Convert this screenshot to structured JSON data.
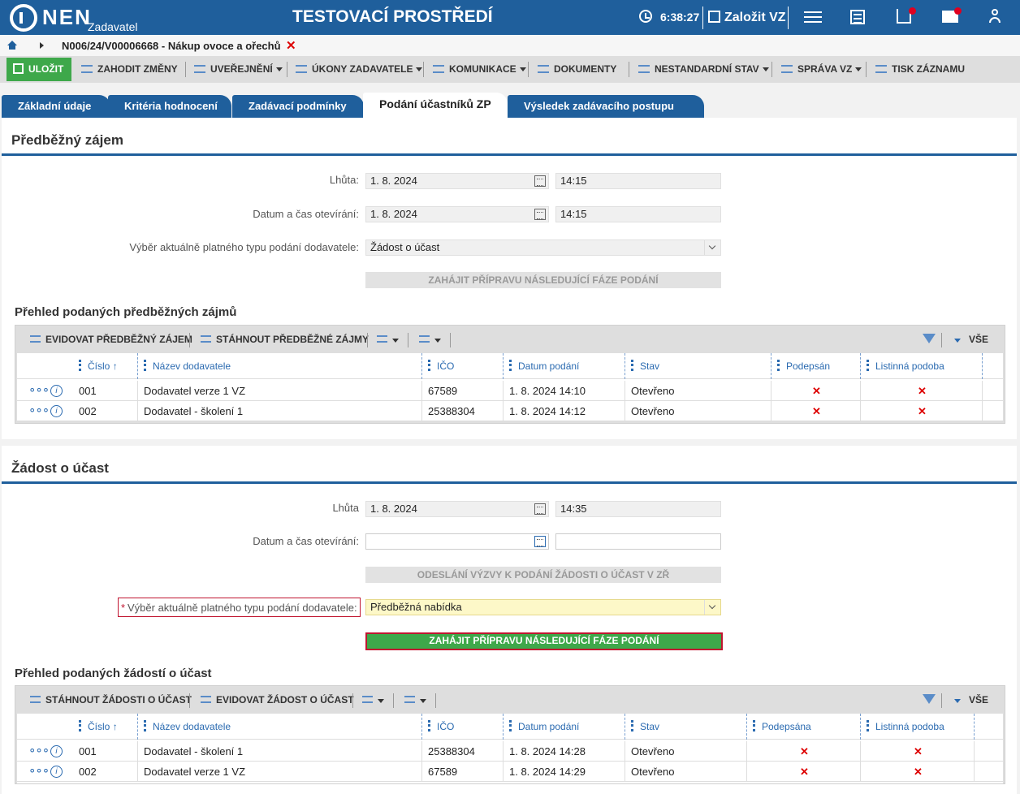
{
  "header": {
    "brand": "NEN",
    "brand_sub": "Zadavatel",
    "environment": "TESTOVACÍ PROSTŘEDÍ",
    "time": "6:38:27",
    "new_vz": "Založit VZ"
  },
  "breadcrumb": {
    "text": "N006/24/V00006668 - Nákup ovoce a ořechů",
    "close": "✕"
  },
  "toolbar": {
    "save": "ULOŽIT",
    "discard": "ZAHODIT ZMĚNY",
    "publishing": "UVEŘEJNĚNÍ",
    "actions": "ÚKONY ZADAVATELE",
    "communication": "KOMUNIKACE",
    "documents": "DOKUMENTY",
    "nonstandard": "NESTANDARDNÍ STAV",
    "management": "SPRÁVA VZ",
    "print": "TISK ZÁZNAMU"
  },
  "tabs": [
    "Základní údaje",
    "Kritéria hodnocení",
    "Zadávací podmínky",
    "Podání účastníků ZP",
    "Výsledek zadávacího postupu"
  ],
  "section1": {
    "title": "Předběžný zájem",
    "deadline_label": "Lhůta:",
    "deadline_date": "1. 8. 2024",
    "deadline_time": "14:15",
    "opening_label": "Datum a čas otevírání:",
    "opening_date": "1. 8. 2024",
    "opening_time": "14:15",
    "type_label": "Výběr aktuálně platného typu podání dodavatele:",
    "type_value": "Žádost o účast",
    "start_button": "ZAHÁJIT PŘÍPRAVU NÁSLEDUJÍCÍ FÁZE PODÁNÍ",
    "grid_title": "Přehled podaných předběžných zájmů",
    "grid_btn1": "EVIDOVAT PŘEDBĚŽNÝ ZÁJEM",
    "grid_btn2": "STÁHNOUT PŘEDBĚŽNÉ ZÁJMY",
    "all": "VŠE",
    "columns": [
      "Číslo",
      "Název dodavatele",
      "IČO",
      "Datum podání",
      "Stav",
      "Podepsán",
      "Listinná podoba"
    ],
    "rows": [
      {
        "no": "001",
        "name": "Dodavatel verze 1 VZ",
        "ico": "67589",
        "date": "1. 8. 2024 14:10",
        "state": "Otevřeno",
        "signed": "✕",
        "paper": "✕"
      },
      {
        "no": "002",
        "name": "Dodavatel - školení 1",
        "ico": "25388304",
        "date": "1. 8. 2024 14:12",
        "state": "Otevřeno",
        "signed": "✕",
        "paper": "✕"
      }
    ]
  },
  "section2": {
    "title": "Žádost o účast",
    "deadline_label": "Lhůta",
    "deadline_date": "1. 8. 2024",
    "deadline_time": "14:35",
    "opening_label": "Datum a čas otevírání:",
    "opening_date": "",
    "opening_time": "",
    "send_button": "ODESLÁNÍ VÝZVY K PODÁNÍ ŽÁDOSTI O ÚČAST V ZŘ",
    "type_label": "Výběr aktuálně platného typu podání dodavatele:",
    "required_mark": "*",
    "type_value": "Předběžná nabídka",
    "start_button": "ZAHÁJIT PŘÍPRAVU NÁSLEDUJÍCÍ FÁZE PODÁNÍ",
    "grid_title": "Přehled podaných žádostí o účast",
    "grid_btn1": "STÁHNOUT ŽÁDOSTI O ÚČAST",
    "grid_btn2": "EVIDOVAT ŽÁDOST O ÚČAST",
    "all": "VŠE",
    "columns": [
      "Číslo",
      "Název dodavatele",
      "IČO",
      "Datum podání",
      "Stav",
      "Podepsána",
      "Listinná podoba"
    ],
    "rows": [
      {
        "no": "001",
        "name": "Dodavatel - školení 1",
        "ico": "25388304",
        "date": "1. 8. 2024 14:28",
        "state": "Otevřeno",
        "signed": "✕",
        "paper": "✕"
      },
      {
        "no": "002",
        "name": "Dodavatel verze 1 VZ",
        "ico": "67589",
        "date": "1. 8. 2024 14:29",
        "state": "Otevřeno",
        "signed": "✕",
        "paper": "✕"
      }
    ]
  },
  "row_menu": "∘∘∘",
  "row_info": "i",
  "sort_arrow": "↑",
  "colors": {
    "brand_blue": "#1f5f9c",
    "save_green": "#3ea84a",
    "error_red": "#c01530"
  }
}
